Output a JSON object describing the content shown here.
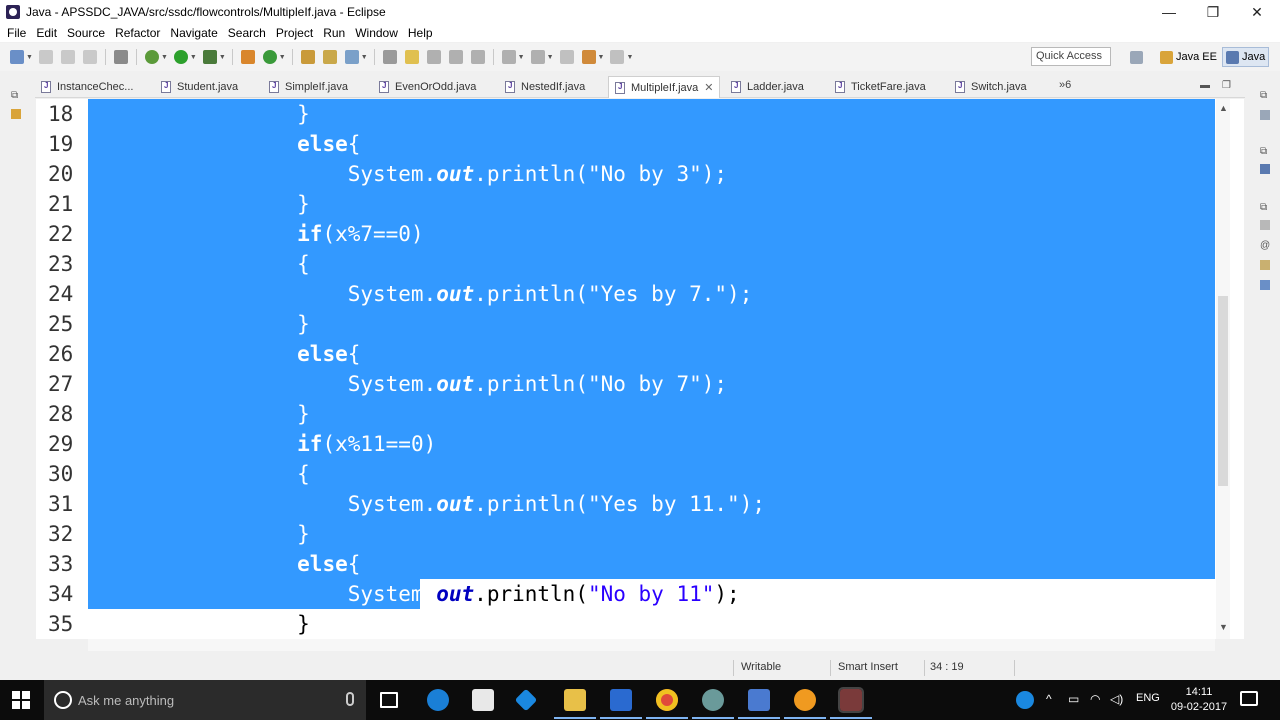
{
  "window": {
    "title": "Java - APSSDC_JAVA/src/ssdc/flowcontrols/MultipleIf.java - Eclipse",
    "controls": {
      "minimize": "—",
      "restore": "❐",
      "close": "✕"
    }
  },
  "menu": [
    "File",
    "Edit",
    "Source",
    "Refactor",
    "Navigate",
    "Search",
    "Project",
    "Run",
    "Window",
    "Help"
  ],
  "toolbar": {
    "quick_access": "Quick Access",
    "perspectives": [
      {
        "label": "Java EE",
        "active": false
      },
      {
        "label": "Java",
        "active": true
      }
    ]
  },
  "tabs": {
    "items": [
      {
        "label": "InstanceChec..."
      },
      {
        "label": "Student.java"
      },
      {
        "label": "SimpleIf.java"
      },
      {
        "label": "EvenOrOdd.java"
      },
      {
        "label": "NestedIf.java"
      },
      {
        "label": "MultipleIf.java",
        "active": true,
        "close": "✕"
      },
      {
        "label": "Ladder.java"
      },
      {
        "label": "TicketFare.java"
      },
      {
        "label": "Switch.java"
      }
    ],
    "overflow": "»6"
  },
  "editor": {
    "lines": [
      {
        "num": "18",
        "text": "        }"
      },
      {
        "num": "19",
        "kw": "else",
        "rest": "{",
        "indent": "        "
      },
      {
        "num": "20",
        "indent": "            ",
        "sys": "System.",
        "out": "out",
        "mid": ".println(",
        "str": "\"No by 3\"",
        "end": ");"
      },
      {
        "num": "21",
        "text": "        }"
      },
      {
        "num": "22",
        "kw": "if",
        "rest": "(x%7==0)",
        "indent": "        "
      },
      {
        "num": "23",
        "text": "        {"
      },
      {
        "num": "24",
        "indent": "            ",
        "sys": "System.",
        "out": "out",
        "mid": ".println(",
        "str": "\"Yes by 7.\"",
        "end": ");"
      },
      {
        "num": "25",
        "text": "        }"
      },
      {
        "num": "26",
        "kw": "else",
        "rest": "{",
        "indent": "        "
      },
      {
        "num": "27",
        "indent": "            ",
        "sys": "System.",
        "out": "out",
        "mid": ".println(",
        "str": "\"No by 7\"",
        "end": ");"
      },
      {
        "num": "28",
        "text": "        }"
      },
      {
        "num": "29",
        "kw": "if",
        "rest": "(x%11==0)",
        "indent": "        "
      },
      {
        "num": "30",
        "text": "        {"
      },
      {
        "num": "31",
        "indent": "            ",
        "sys": "System.",
        "out": "out",
        "mid": ".println(",
        "str": "\"Yes by 11.\"",
        "end": ");"
      },
      {
        "num": "32",
        "text": "        }"
      },
      {
        "num": "33",
        "kw": "else",
        "rest": "{",
        "indent": "        "
      },
      {
        "num": "34",
        "indent": "            ",
        "sys": "System.",
        "out": "out",
        "mid": ".println(",
        "str": "\"No by 11\"",
        "end": ");",
        "partial": true
      },
      {
        "num": "35",
        "text": "        }",
        "plain": true
      }
    ]
  },
  "status": {
    "writable": "Writable",
    "insert_mode": "Smart Insert",
    "position": "34 : 19"
  },
  "taskbar": {
    "search_placeholder": "Ask me anything",
    "lang": "ENG",
    "time": "14:11",
    "date": "09-02-2017"
  },
  "colors": {
    "selection": "#3399ff",
    "keyword": "#7f0055",
    "string": "#2a00ff",
    "field": "#0000c0"
  }
}
